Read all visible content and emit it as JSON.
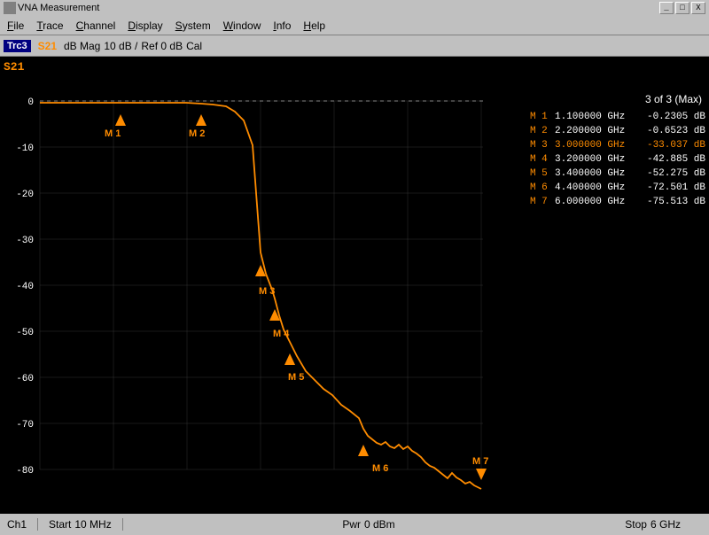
{
  "titlebar": {
    "title": "VNA Measurement",
    "minimize": "_",
    "maximize": "□",
    "close": "X"
  },
  "menubar": {
    "items": [
      {
        "label": "File",
        "underline": 0
      },
      {
        "label": "Trace",
        "underline": 0
      },
      {
        "label": "Channel",
        "underline": 0
      },
      {
        "label": "Display",
        "underline": 0
      },
      {
        "label": "System",
        "underline": 0
      },
      {
        "label": "Window",
        "underline": 0
      },
      {
        "label": "Info",
        "underline": 0
      },
      {
        "label": "Help",
        "underline": 0
      }
    ]
  },
  "toolbar": {
    "trc_label": "Trc3",
    "s_param": "S21",
    "format": "dB Mag",
    "scale": "10 dB /",
    "ref": "Ref 0 dB",
    "cal": "Cal"
  },
  "top_right": {
    "text": "3 of 3 (Max)"
  },
  "s21_label": "S21",
  "markers": [
    {
      "id": "M 1",
      "freq": "1.100000 GHz",
      "val": "-0.2305 dB",
      "active": false
    },
    {
      "id": "M 2",
      "freq": "2.200000 GHz",
      "val": "-0.6523 dB",
      "active": false
    },
    {
      "id": "M 3",
      "freq": "3.000000 GHz",
      "val": "-33.037 dB",
      "active": true
    },
    {
      "id": "M 4",
      "freq": "3.200000 GHz",
      "val": "-42.885 dB",
      "active": false
    },
    {
      "id": "M 5",
      "freq": "3.400000 GHz",
      "val": "-52.275 dB",
      "active": false
    },
    {
      "id": "M 6",
      "freq": "4.400000 GHz",
      "val": "-72.501 dB",
      "active": false
    },
    {
      "id": "M 7",
      "freq": "6.000000 GHz",
      "val": "-75.513 dB",
      "active": false
    }
  ],
  "statusbar": {
    "channel": "Ch1",
    "start_label": "Start",
    "start_val": "10 MHz",
    "pwr_label": "Pwr",
    "pwr_val": "0 dBm",
    "stop_label": "Stop",
    "stop_val": "6 GHz"
  },
  "chart": {
    "y_labels": [
      "0",
      "-10",
      "-20",
      "-30",
      "-40",
      "-50",
      "-60",
      "-70",
      "-80"
    ],
    "accent_color": "#ff8c00",
    "grid_color": "#333333"
  }
}
